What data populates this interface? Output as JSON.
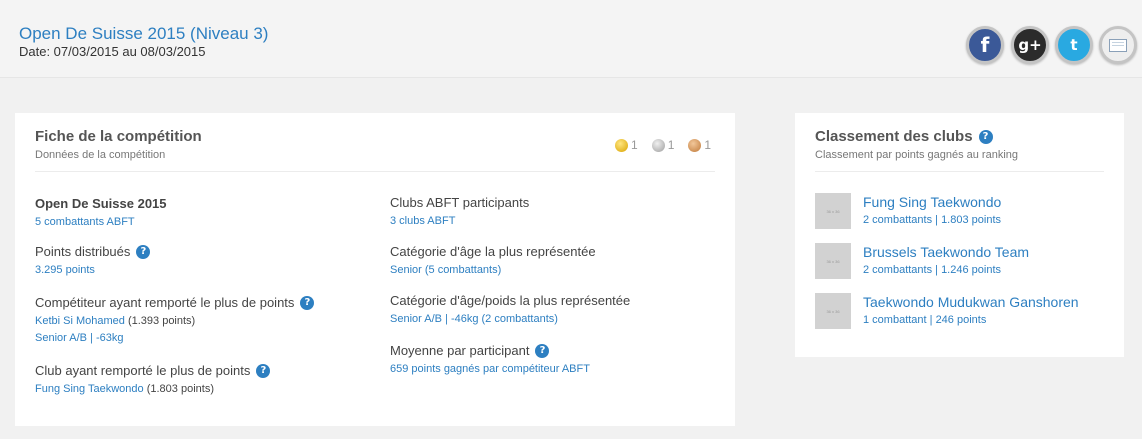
{
  "header": {
    "title": "Open De Suisse 2015 (Niveau 3)",
    "date": "Date: 07/03/2015 au 08/03/2015"
  },
  "social": {
    "facebook_icon": "f",
    "googleplus_icon": "g+",
    "twitter_icon": "t"
  },
  "competition": {
    "title": "Fiche de la compétition",
    "subtitle": "Données de la compétition",
    "medals": {
      "gold": "1",
      "silver": "1",
      "bronze": "1"
    },
    "name": "Open De Suisse 2015",
    "name_value": "5 combattants ABFT",
    "points_label": "Points distribués",
    "points_value": "3.295 points",
    "top_competitor_label": "Compétiteur ayant remporté le plus de points",
    "top_competitor_name": "Ketbi Si Mohamed",
    "top_competitor_points": "(1.393 points)",
    "top_competitor_category": "Senior A/B | -63kg",
    "top_club_label": "Club ayant remporté le plus de points",
    "top_club_name": "Fung Sing Taekwondo",
    "top_club_points": "(1.803 points)",
    "clubs_label": "Clubs ABFT participants",
    "clubs_value": "3 clubs ABFT",
    "age_cat_label": "Catégorie d'âge la plus représentée",
    "age_cat_value": "Senior (5 combattants)",
    "age_weight_label": "Catégorie d'âge/poids la plus représentée",
    "age_weight_value": "Senior A/B | -46kg (2 combattants)",
    "average_label": "Moyenne par participant",
    "average_value": "659 points gagnés par compétiteur ABFT",
    "help_glyph": "?"
  },
  "ranking": {
    "title": "Classement des clubs",
    "subtitle": "Classement par points gagnés au ranking",
    "placeholder": "36 x 36",
    "clubs": [
      {
        "name": "Fung Sing Taekwondo",
        "stats": "2 combattants | 1.803 points"
      },
      {
        "name": "Brussels Taekwondo Team",
        "stats": "2 combattants | 1.246 points"
      },
      {
        "name": "Taekwondo Mudukwan Ganshoren",
        "stats": "1 combattant | 246 points"
      }
    ]
  },
  "colors": {
    "link": "#2d7fc1",
    "facebook": "#3b5998",
    "googleplus": "#2b2b2b",
    "twitter": "#29a9e1"
  }
}
